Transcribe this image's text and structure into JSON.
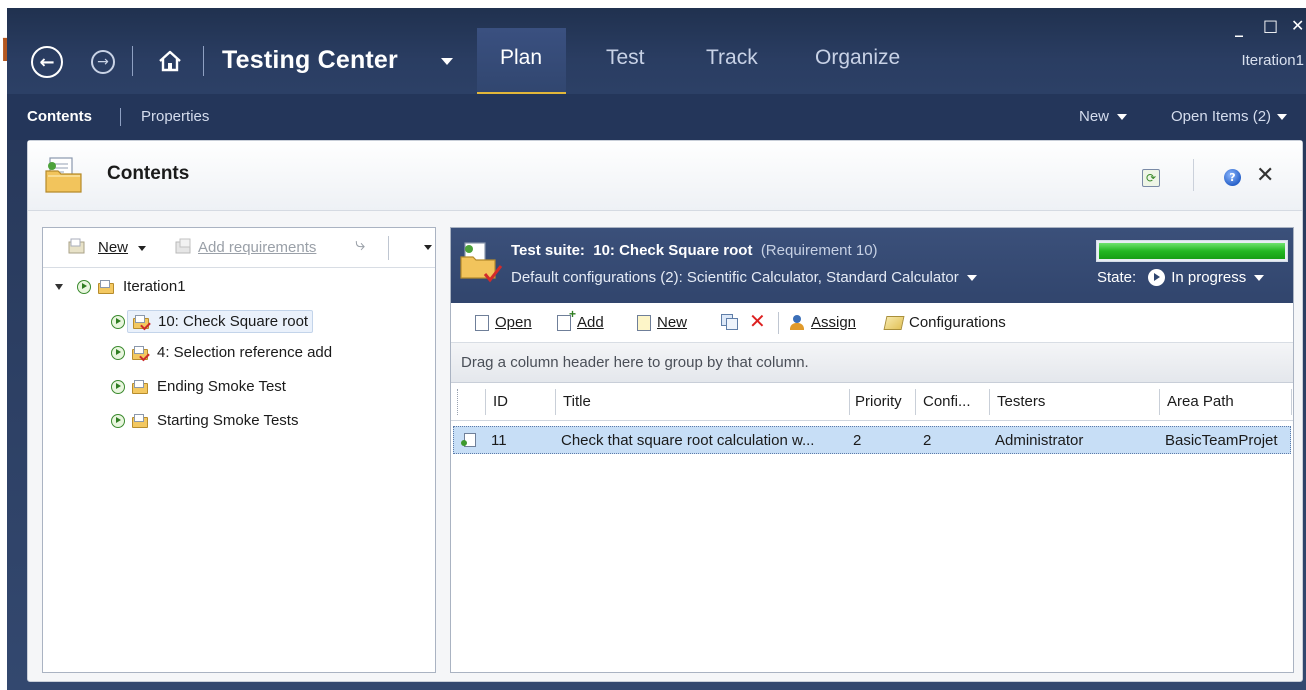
{
  "window": {
    "app_title": "Testing Center",
    "tabs": [
      {
        "label": "Plan"
      },
      {
        "label": "Test"
      },
      {
        "label": "Track"
      },
      {
        "label": "Organize"
      }
    ],
    "controls": {
      "minimize": "_",
      "maximize": "□",
      "close": "✕"
    },
    "iteration_label": "Iteration1"
  },
  "subnav": {
    "contents": "Contents",
    "properties": "Properties",
    "new": "New",
    "open_items": "Open Items (2)"
  },
  "panel": {
    "title": "Contents",
    "close_glyph": "✕",
    "help_glyph": "?"
  },
  "left_toolbar": {
    "new": "New",
    "add_requirements": "Add requirements"
  },
  "tree": {
    "root": "Iteration1",
    "children": [
      {
        "label": "10: Check Square root"
      },
      {
        "label": "4: Selection reference add"
      },
      {
        "label": "Ending Smoke Test"
      },
      {
        "label": "Starting Smoke Tests"
      }
    ]
  },
  "suite": {
    "prefix": "Test suite:",
    "name": "10: Check Square root",
    "requirement": "(Requirement 10)",
    "configs": "Default configurations (2):  Scientific Calculator, Standard Calculator",
    "state_label": "State:",
    "state_value": "In progress",
    "progress_fraction": 1.0,
    "progress_color": "#1fb21f"
  },
  "right_toolbar": {
    "open": "Open",
    "add": "Add",
    "new": "New",
    "assign": "Assign",
    "configurations": "Configurations"
  },
  "grid": {
    "group_hint": "Drag a column header here to group by that column.",
    "columns": [
      "ID",
      "Title",
      "Priority",
      "Confi...",
      "Testers",
      "Area Path"
    ],
    "rows": [
      {
        "id": "11",
        "title": "Check that square root calculation w...",
        "priority": "2",
        "config": "2",
        "testers": "Administrator",
        "area_path": "BasicTeamProjet"
      }
    ]
  },
  "colors": {
    "chrome_dark": "#24365a",
    "accent_tab": "#e2b73a",
    "row_selected": "#c7def6"
  }
}
